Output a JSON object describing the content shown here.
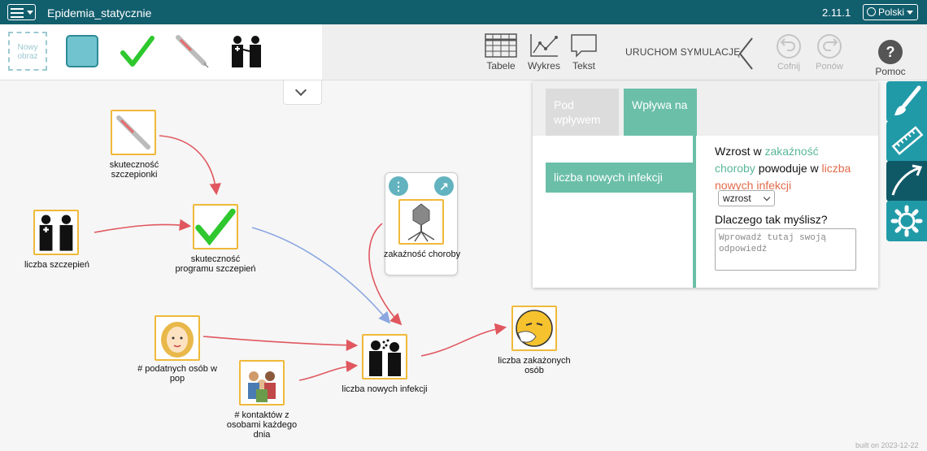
{
  "header": {
    "title": "Epidemia_statycznie",
    "version": "2.11.1",
    "language": "Polski"
  },
  "palette": {
    "new_image_label": "Nowy obraz",
    "items": [
      "teal-square",
      "checkmark-icon",
      "syringe-icon",
      "vaccination-icon"
    ]
  },
  "toolbar": {
    "tables_label": "Tabele",
    "chart_label": "Wykres",
    "text_label": "Tekst",
    "run_sim_label": "URUCHOM SYMULACJĘ",
    "undo_label": "Cofnij",
    "redo_label": "Ponów",
    "help_label": "Pomoc",
    "help_glyph": "?"
  },
  "nodes": {
    "vaccine_eff": "skuteczność szczepionki",
    "vaccinations": "liczba szczepień",
    "program_eff": "skuteczność programu szczepień",
    "susceptible": "# podatnych osób w pop",
    "contacts": "# kontaktów z osobami każdego dnia",
    "new_infections": "liczba nowych infekcji",
    "infected": "liczba zakażonych osób",
    "infectiousness": "zakaźność choroby"
  },
  "card": {
    "menu_glyph": "⋮",
    "link_glyph": "↗"
  },
  "panel": {
    "tab_influenced": "Pod wpływem",
    "tab_influences": "Wpływa na",
    "selected_variable": "liczba nowych infekcji",
    "sentence_a": "Wzrost w ",
    "sentence_b": "zakaźność choroby",
    "sentence_c": " powoduje w ",
    "sentence_d": "liczba nowych infekcji",
    "select_value": "wzrost",
    "why_label": "Dlaczego tak myślisz?",
    "why_placeholder": "Wprowadź tutaj swoją odpowiedź"
  },
  "colors": {
    "topbar": "#115e6d",
    "accent_green": "#6bbfa9",
    "side_tool": "#219aa8",
    "node_border": "#f0b93a",
    "arrow_red": "#e0575f",
    "arrow_blue": "#8aa7e0"
  },
  "side_tools": [
    "brush-icon",
    "ruler-icon",
    "relationship-arrow-icon",
    "settings-gear-icon"
  ],
  "footer": {
    "built": "built on 2023-12-22"
  }
}
